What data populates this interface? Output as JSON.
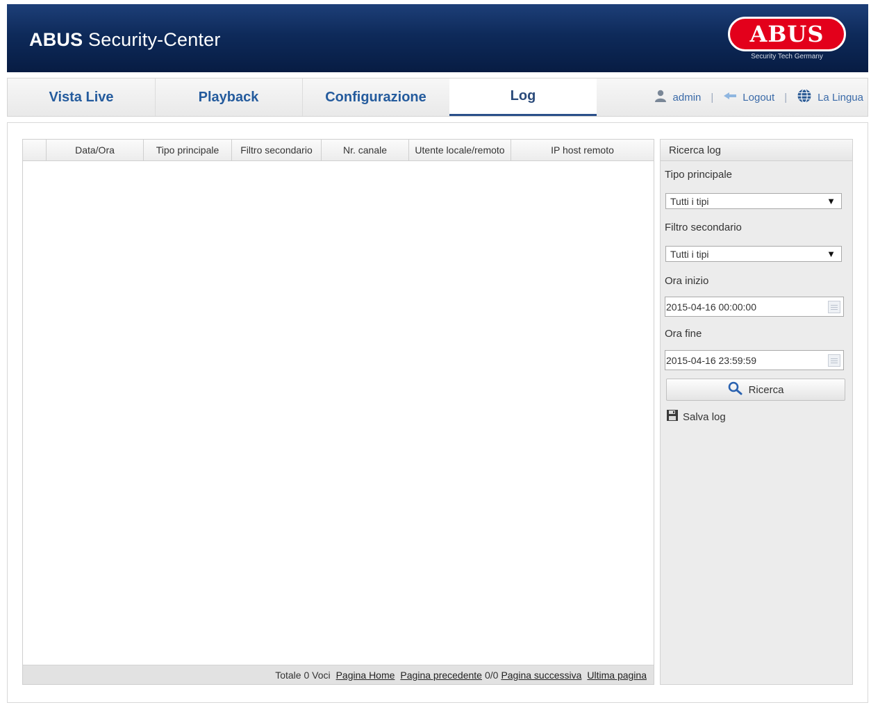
{
  "header": {
    "brand": "ABUS",
    "title_rest": "Security-Center",
    "logo_text": "ABUS",
    "logo_tagline": "Security Tech Germany"
  },
  "nav": {
    "tabs": [
      {
        "label": "Vista Live",
        "active": false
      },
      {
        "label": "Playback",
        "active": false
      },
      {
        "label": "Configurazione",
        "active": false
      },
      {
        "label": "Log",
        "active": true
      }
    ],
    "user": "admin",
    "logout": "Logout",
    "language": "La Lingua",
    "separator": "|"
  },
  "table": {
    "columns": [
      "",
      "Data/Ora",
      "Tipo principale",
      "Filtro secondario",
      "Nr. canale",
      "Utente locale/remoto",
      "IP host remoto"
    ],
    "rows": [],
    "footer": {
      "total": "Totale 0 Voci",
      "home": "Pagina Home",
      "prev": "Pagina precedente",
      "page_count": "0/0",
      "next": "Pagina successiva",
      "last": "Ultima pagina"
    }
  },
  "search_panel": {
    "title": "Ricerca log",
    "main_type_label": "Tipo principale",
    "main_type_value": "Tutti i tipi",
    "sub_filter_label": "Filtro secondario",
    "sub_filter_value": "Tutti i tipi",
    "start_label": "Ora inizio",
    "start_value": "2015-04-16 00:00:00",
    "end_label": "Ora fine",
    "end_value": "2015-04-16 23:59:59",
    "search_button": "Ricerca",
    "save_log": "Salva log"
  },
  "colors": {
    "header_bg": "#0e2a5a",
    "tab_text": "#245b9d",
    "logo_red": "#e3001b"
  }
}
